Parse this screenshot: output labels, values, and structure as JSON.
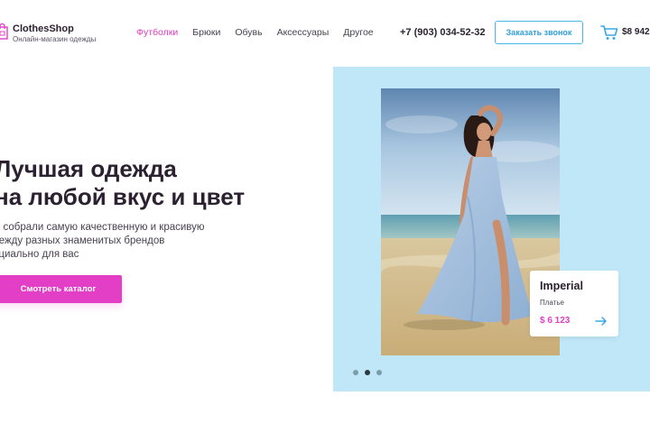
{
  "brand": {
    "name": "ClothesShop",
    "tagline": "Онлайн-магазин одежды",
    "logo_icon": "shopping-bag-icon"
  },
  "nav": {
    "items": [
      {
        "label": "Футболки",
        "active": true
      },
      {
        "label": "Брюки",
        "active": false
      },
      {
        "label": "Обувь",
        "active": false
      },
      {
        "label": "Аксессуары",
        "active": false
      },
      {
        "label": "Другое",
        "active": false
      }
    ]
  },
  "header": {
    "phone": "+7 (903) 034-52-32",
    "callback_label": "Заказать звонок",
    "cart_icon": "cart-icon",
    "cart_total": "$8 942"
  },
  "hero": {
    "title_line1": "Лучшая одежда",
    "title_line2": "на любой вкус и цвет",
    "desc_line1": "ы собрали самую качественную и красивую",
    "desc_line2": "дежду разных знаменитых брендов",
    "desc_line3": "ециально для вас",
    "cta_label": "Смотреть каталог"
  },
  "slider": {
    "slides_total": 3,
    "active_index": 1,
    "product": {
      "name": "Imperial",
      "type": "Платье",
      "price": "$ 6 123",
      "arrow_icon": "arrow-right-icon"
    }
  },
  "colors": {
    "accent_pink": "#e23fc6",
    "accent_blue": "#48b7e8",
    "panel_blue": "#bfe7f7",
    "text_dark": "#2b2130"
  }
}
